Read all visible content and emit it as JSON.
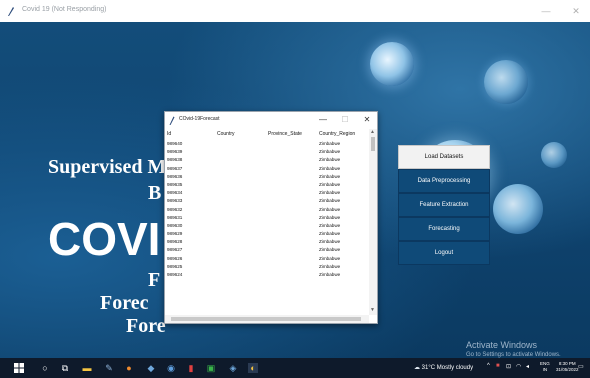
{
  "outer_window": {
    "title": "Covid 19 (Not Responding)",
    "minimize": "—",
    "close": "✕"
  },
  "background_text": {
    "line1": "Supervised M",
    "line2": "B",
    "line3": "COVI",
    "line4": "F",
    "line5": "Forec",
    "line6": "Fore"
  },
  "menu": {
    "items": [
      {
        "label": "Load Datasets"
      },
      {
        "label": "Data Preprocessing"
      },
      {
        "label": "Feature Extraction"
      },
      {
        "label": "Forecasting"
      },
      {
        "label": "Logout"
      }
    ]
  },
  "inner_window": {
    "title": "COvid-19Forecast",
    "minimize": "—",
    "maximize": "☐",
    "close": "✕",
    "columns": [
      "Id",
      "Country",
      "Province_State",
      "Country_Region"
    ],
    "rows": [
      [
        "989640",
        "Zimbabwe"
      ],
      [
        "989639",
        "Zimbabwe"
      ],
      [
        "989638",
        "Zimbabwe"
      ],
      [
        "989637",
        "Zimbabwe"
      ],
      [
        "989636",
        "Zimbabwe"
      ],
      [
        "989635",
        "Zimbabwe"
      ],
      [
        "989634",
        "Zimbabwe"
      ],
      [
        "989633",
        "Zimbabwe"
      ],
      [
        "989632",
        "Zimbabwe"
      ],
      [
        "989631",
        "Zimbabwe"
      ],
      [
        "989630",
        "Zimbabwe"
      ],
      [
        "989629",
        "Zimbabwe"
      ],
      [
        "989628",
        "Zimbabwe"
      ],
      [
        "989627",
        "Zimbabwe"
      ],
      [
        "989626",
        "Zimbabwe"
      ],
      [
        "989625",
        "Zimbabwe"
      ],
      [
        "989624",
        "Zimbabwe"
      ]
    ]
  },
  "watermark": {
    "title": "Activate Windows",
    "subtitle": "Go to Settings to activate Windows."
  },
  "taskbar": {
    "weather": "31°C Mostly cloudy",
    "lang_top": "ENG",
    "lang_bottom": "IN",
    "time": "8:30 PM",
    "date": "31/05/2022"
  },
  "colors": {
    "background": "#0f4470",
    "menu_button": "#0f4a78",
    "taskbar": "#0e1a2b"
  }
}
